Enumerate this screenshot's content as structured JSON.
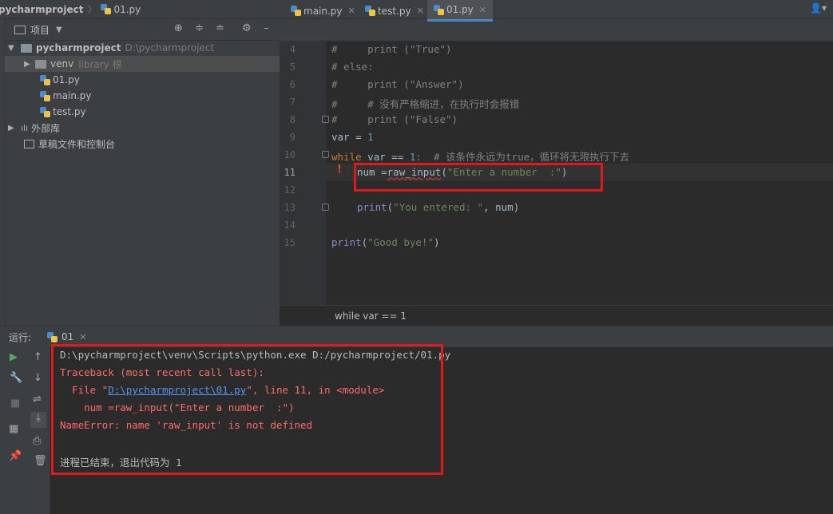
{
  "breadcrumb": {
    "project": "pycharmproject",
    "file": "01.py"
  },
  "sidebar": {
    "header_label": "项目",
    "tree": {
      "root": {
        "name": "pycharmproject",
        "path": "D:\\pycharmproject"
      },
      "venv": {
        "name": "venv",
        "note": "library 根"
      },
      "files": [
        "01.py",
        "main.py",
        "test.py"
      ],
      "external": "外部库",
      "scratches": "草稿文件和控制台"
    }
  },
  "tabs": [
    {
      "label": "main.py",
      "active": false
    },
    {
      "label": "test.py",
      "active": false
    },
    {
      "label": "01.py",
      "active": true
    }
  ],
  "editor": {
    "line_numbers": [
      "4",
      "5",
      "6",
      "7",
      "8",
      "9",
      "10",
      "11",
      "12",
      "13",
      "14",
      "15"
    ],
    "lines": {
      "l4a": "#     print (",
      "l4b": "\"True\"",
      "l4c": ")",
      "l5": "# else:",
      "l6a": "#     print (",
      "l6b": "\"Answer\"",
      "l6c": ")",
      "l7": "#     # 没有严格缩进，在执行时会报错",
      "l8a": "#     print (",
      "l8b": "\"False\"",
      "l8c": ")",
      "l9a": "var = ",
      "l9b": "1",
      "l10a": "while",
      "l10b": " var == ",
      "l10c": "1",
      "l10d": ":  # 该条件永远为true，循环将无限执行下去",
      "l11a": "num =",
      "l11b": "raw_input",
      "l11c": "(",
      "l11d": "\"Enter a number  :\"",
      "l11e": ")",
      "l13a": "print",
      "l13b": "(",
      "l13c": "\"You entered: \"",
      "l13d": ", num)",
      "l15a": "print",
      "l15b": "(",
      "l15c": "\"Good bye!\"",
      "l15d": ")"
    },
    "status": "while var == 1"
  },
  "run": {
    "label": "运行:",
    "tab": "01",
    "console": {
      "cmd": "D:\\pycharmproject\\venv\\Scripts\\python.exe D:/pycharmproject/01.py",
      "traceback": "Traceback (most recent call last):",
      "file_prefix": "  File \"",
      "file_link": "D:\\pycharmproject\\01.py",
      "file_suffix": "\", line 11, in <module>",
      "code": "    num =raw_input(\"Enter a number  :\")",
      "error": "NameError: name 'raw_input' is not defined",
      "exit": "进程已结束，退出代码为 1"
    }
  },
  "colors": {
    "error_box": "#e01a1a",
    "active_tab": "#4a88c7"
  }
}
